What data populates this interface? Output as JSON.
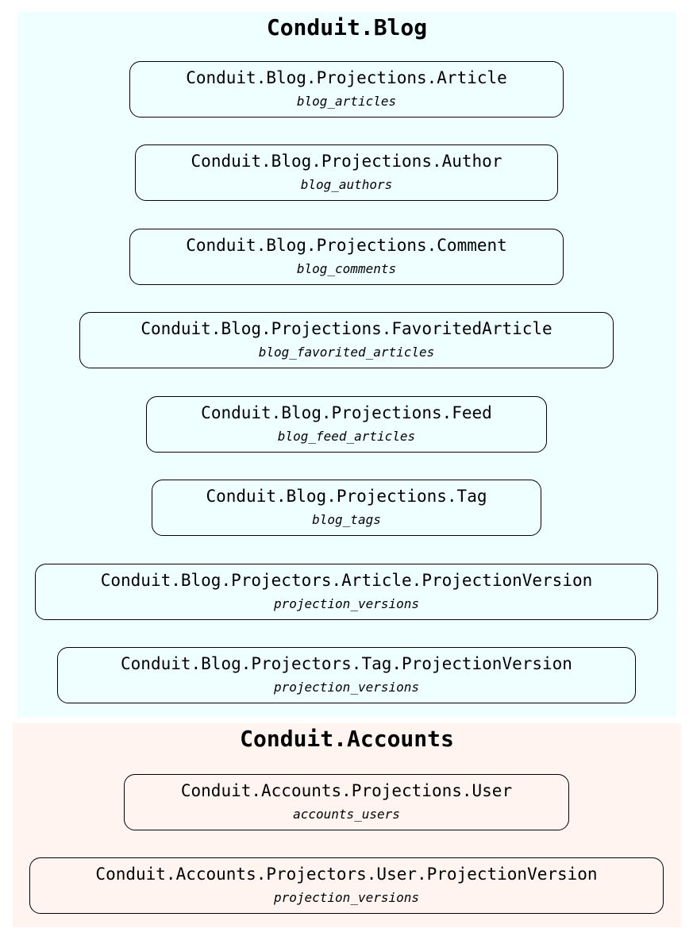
{
  "colors": {
    "blog_cluster_fill": "#efffff",
    "accounts_cluster_fill": "#fff4f0",
    "node_border": "#000000"
  },
  "clusters": [
    {
      "title": "Conduit.Blog",
      "nodes": [
        {
          "module": "Conduit.Blog.Projections.Article",
          "table": "blog_articles"
        },
        {
          "module": "Conduit.Blog.Projections.Author",
          "table": "blog_authors"
        },
        {
          "module": "Conduit.Blog.Projections.Comment",
          "table": "blog_comments"
        },
        {
          "module": "Conduit.Blog.Projections.FavoritedArticle",
          "table": "blog_favorited_articles"
        },
        {
          "module": "Conduit.Blog.Projections.Feed",
          "table": "blog_feed_articles"
        },
        {
          "module": "Conduit.Blog.Projections.Tag",
          "table": "blog_tags"
        },
        {
          "module": "Conduit.Blog.Projectors.Article.ProjectionVersion",
          "table": "projection_versions"
        },
        {
          "module": "Conduit.Blog.Projectors.Tag.ProjectionVersion",
          "table": "projection_versions"
        }
      ]
    },
    {
      "title": "Conduit.Accounts",
      "nodes": [
        {
          "module": "Conduit.Accounts.Projections.User",
          "table": "accounts_users"
        },
        {
          "module": "Conduit.Accounts.Projectors.User.ProjectionVersion",
          "table": "projection_versions"
        }
      ]
    }
  ]
}
